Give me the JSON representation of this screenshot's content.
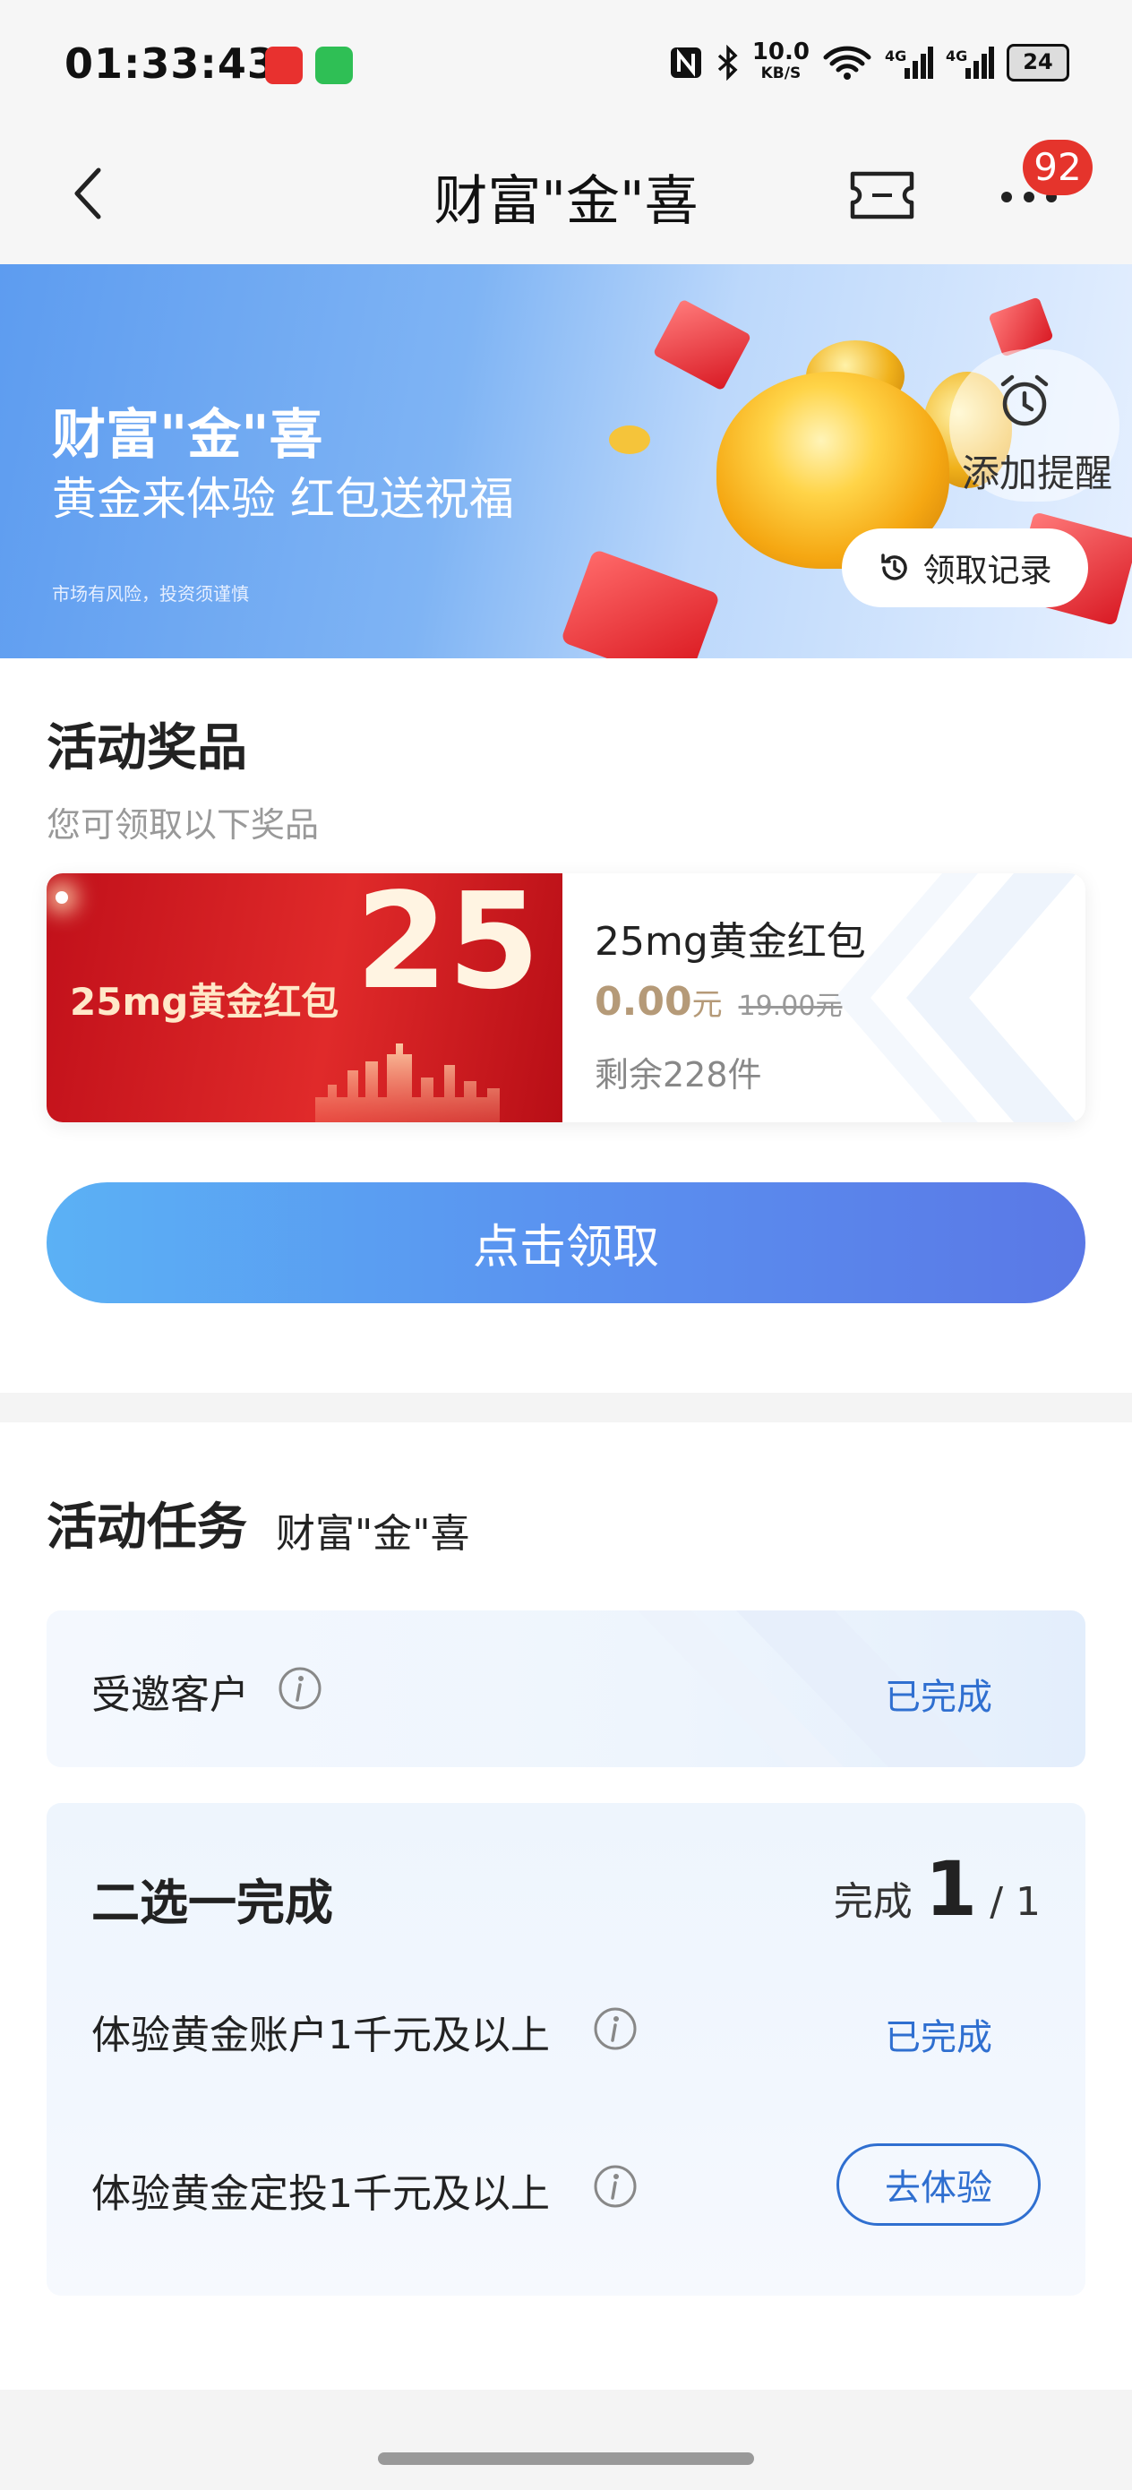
{
  "status_bar": {
    "time": "01:33:43",
    "net_speed": "10.0",
    "net_unit": "KB/S",
    "battery": "24"
  },
  "nav": {
    "title": "财富\"金\"喜",
    "badge": "92"
  },
  "banner": {
    "title": "财富\"金\"喜",
    "subtitle": "黄金来体验 红包送祝福",
    "risk_note": "市场有风险，投资须谨慎",
    "remind_label": "添加提醒",
    "record_label": "领取记录"
  },
  "prizes": {
    "title": "活动奖品",
    "subtitle": "您可领取以下奖品",
    "item": {
      "image_number": "25",
      "image_label": "25mg黄金红包",
      "name": "25mg黄金红包",
      "price": "0.00",
      "price_unit": "元",
      "original_price": "19.00元",
      "stock": "剩余228件"
    },
    "claim_button": "点击领取"
  },
  "tasks": {
    "title": "活动任务",
    "subtitle": "财富\"金\"喜",
    "invited": {
      "label": "受邀客户",
      "status": "已完成"
    },
    "choose": {
      "title": "二选一完成",
      "progress_label": "完成",
      "progress_done": "1",
      "progress_total": "/ 1",
      "items": [
        {
          "label": "体验黄金账户1千元及以上",
          "status": "已完成"
        },
        {
          "label": "体验黄金定投1千元及以上",
          "action": "去体验"
        }
      ]
    }
  },
  "colors": {
    "accent": "#2f6fd0",
    "price": "#b59a78",
    "badge": "#e5342c",
    "button_start": "#5bb1f5",
    "button_end": "#5a78e6"
  }
}
